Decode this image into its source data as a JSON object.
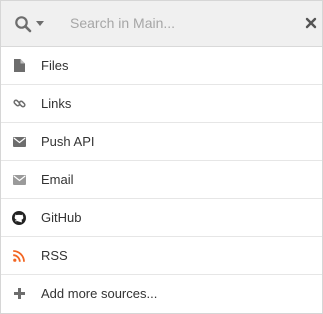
{
  "search": {
    "placeholder": "Search in Main..."
  },
  "sources": [
    {
      "label": "Files",
      "icon": "file-icon"
    },
    {
      "label": "Links",
      "icon": "link-icon"
    },
    {
      "label": "Push API",
      "icon": "envelope-icon"
    },
    {
      "label": "Email",
      "icon": "envelope-icon"
    },
    {
      "label": "GitHub",
      "icon": "github-icon"
    },
    {
      "label": "RSS",
      "icon": "rss-icon"
    },
    {
      "label": "Add more sources...",
      "icon": "plus-icon"
    }
  ],
  "colors": {
    "icon": "#6d6d6d",
    "email_icon": "#9a9a9a",
    "rss": "#f26522",
    "header_bg": "#f0f0f0"
  }
}
